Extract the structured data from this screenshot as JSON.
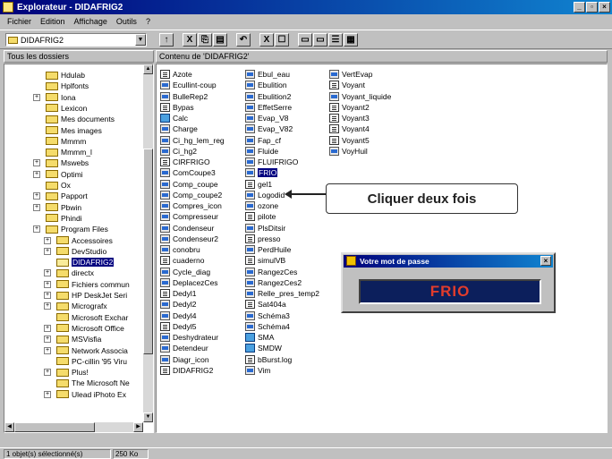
{
  "window": {
    "title": "Explorateur - DIDAFRIG2",
    "minimize": "_",
    "maximize": "▫",
    "close": "×"
  },
  "menu": [
    "Fichier",
    "Edition",
    "Affichage",
    "Outils",
    "?"
  ],
  "address": {
    "value": "DIDAFRIG2"
  },
  "toolbar": {
    "up": "↑",
    "cut": "X",
    "copy": "⎘",
    "paste": "▤",
    "undo": "↶",
    "delete": "X",
    "props": "☐",
    "view1": "▭",
    "view2": "▭",
    "view3": "☰",
    "view4": "▦"
  },
  "headers": {
    "tree": "Tous les dossiers",
    "content": "Contenu de 'DIDAFRIG2'"
  },
  "tree": [
    {
      "label": "Hdulab",
      "plus": false,
      "sel": false
    },
    {
      "label": "Hplfonts",
      "plus": false,
      "sel": false
    },
    {
      "label": "Iona",
      "plus": true,
      "sel": false
    },
    {
      "label": "Lexicon",
      "plus": false,
      "sel": false
    },
    {
      "label": "Mes documents",
      "plus": false,
      "sel": false
    },
    {
      "label": "Mes images",
      "plus": false,
      "sel": false
    },
    {
      "label": "Mmmm",
      "plus": false,
      "sel": false
    },
    {
      "label": "Mmmm_l",
      "plus": false,
      "sel": false
    },
    {
      "label": "Mswebs",
      "plus": true,
      "sel": false
    },
    {
      "label": "Optimi",
      "plus": true,
      "sel": false
    },
    {
      "label": "Ox",
      "plus": false,
      "sel": false
    },
    {
      "label": "Papport",
      "plus": true,
      "sel": false
    },
    {
      "label": "Pbwin",
      "plus": true,
      "sel": false
    },
    {
      "label": "Phindi",
      "plus": false,
      "sel": false
    },
    {
      "label": "Program Files",
      "plus": true,
      "sel": false
    },
    {
      "label": "Accessoires",
      "plus": true,
      "sel": false
    },
    {
      "label": "DevStudio",
      "plus": true,
      "sel": false
    },
    {
      "label": "DIDAFRIG2",
      "plus": false,
      "sel": true
    },
    {
      "label": "directx",
      "plus": true,
      "sel": false
    },
    {
      "label": "Fichiers commun",
      "plus": true,
      "sel": false
    },
    {
      "label": "HP DeskJet Seri",
      "plus": true,
      "sel": false
    },
    {
      "label": "Micrografx",
      "plus": true,
      "sel": false
    },
    {
      "label": "Microsoft Exchar",
      "plus": false,
      "sel": false
    },
    {
      "label": "Microsoft Office",
      "plus": true,
      "sel": false
    },
    {
      "label": "MSVisfia",
      "plus": true,
      "sel": false
    },
    {
      "label": "Network Associa",
      "plus": true,
      "sel": false
    },
    {
      "label": "PC-cillin '95 Viru",
      "plus": false,
      "sel": false
    },
    {
      "label": "Plus!",
      "plus": true,
      "sel": false
    },
    {
      "label": "The Microsoft Ne",
      "plus": false,
      "sel": false
    },
    {
      "label": "Ulead iPhoto Ex",
      "plus": true,
      "sel": false
    }
  ],
  "files": [
    [
      {
        "label": "Azote",
        "icon": "doc"
      },
      {
        "label": "Ecullint-coup",
        "icon": "sc"
      },
      {
        "label": "BulleRep2",
        "icon": "sc"
      },
      {
        "label": "Bypas",
        "icon": "doc"
      },
      {
        "label": "Calc",
        "icon": "app"
      },
      {
        "label": "Charge",
        "icon": "sc"
      },
      {
        "label": "Ci_hg_lem_reg",
        "icon": "sc"
      },
      {
        "label": "Ci_hg2",
        "icon": "sc"
      },
      {
        "label": "CIRFRIGO",
        "icon": "doc"
      },
      {
        "label": "ComCoupe3",
        "icon": "sc"
      },
      {
        "label": "Comp_coupe",
        "icon": "sc"
      },
      {
        "label": "Comp_coupe2",
        "icon": "sc"
      },
      {
        "label": "Compres_icon",
        "icon": "sc"
      },
      {
        "label": "Compresseur",
        "icon": "sc"
      },
      {
        "label": "Condenseur",
        "icon": "sc"
      },
      {
        "label": "Condenseur2",
        "icon": "sc"
      },
      {
        "label": "conobru",
        "icon": "sc"
      },
      {
        "label": "cuaderno",
        "icon": "doc"
      },
      {
        "label": "Cycle_diag",
        "icon": "sc"
      },
      {
        "label": "DeplacezCes",
        "icon": "sc"
      },
      {
        "label": "Dedyl1",
        "icon": "doc"
      },
      {
        "label": "Dedyl2",
        "icon": "sc"
      },
      {
        "label": "Dedyl4",
        "icon": "sc"
      },
      {
        "label": "Dedyl5",
        "icon": "doc"
      },
      {
        "label": "Deshydrateur",
        "icon": "sc"
      },
      {
        "label": "Detendeur",
        "icon": "sc"
      },
      {
        "label": "Diagr_icon",
        "icon": "sc"
      },
      {
        "label": "DIDAFRIG2",
        "icon": "doc"
      }
    ],
    [
      {
        "label": "Ebul_eau",
        "icon": "sc"
      },
      {
        "label": "Ebulition",
        "icon": "sc"
      },
      {
        "label": "Ebulition2",
        "icon": "sc"
      },
      {
        "label": "EffetSerre",
        "icon": "sc"
      },
      {
        "label": "Evap_V8",
        "icon": "sc"
      },
      {
        "label": "Evap_V82",
        "icon": "sc"
      },
      {
        "label": "Fap_cf",
        "icon": "sc"
      },
      {
        "label": "Fluide",
        "icon": "sc"
      },
      {
        "label": "FLUIFRIGO",
        "icon": "sc"
      },
      {
        "label": "FRIO",
        "icon": "sc",
        "sel": true
      },
      {
        "label": "gel1",
        "icon": "doc"
      },
      {
        "label": "Logodid",
        "icon": "sc"
      },
      {
        "label": "ozone",
        "icon": "sc"
      },
      {
        "label": "pilote",
        "icon": "doc"
      },
      {
        "label": "PlsDitsir",
        "icon": "sc"
      },
      {
        "label": "presso",
        "icon": "doc"
      },
      {
        "label": "PerdHuile",
        "icon": "sc"
      },
      {
        "label": "simulVB",
        "icon": "doc"
      },
      {
        "label": "RangezCes",
        "icon": "sc"
      },
      {
        "label": "RangezCes2",
        "icon": "sc"
      },
      {
        "label": "Relle_pres_temp2",
        "icon": "sc"
      },
      {
        "label": "Sat404a",
        "icon": "doc"
      },
      {
        "label": "Schéma3",
        "icon": "sc"
      },
      {
        "label": "Schéma4",
        "icon": "sc"
      },
      {
        "label": "SMA",
        "icon": "app"
      },
      {
        "label": "SMDW",
        "icon": "app"
      },
      {
        "label": "bBurst.log",
        "icon": "doc"
      },
      {
        "label": "Vim",
        "icon": "sc"
      }
    ],
    [
      {
        "label": "VertEvap",
        "icon": "sc"
      },
      {
        "label": "Voyant",
        "icon": "doc"
      },
      {
        "label": "Voyant_liquide",
        "icon": "sc"
      },
      {
        "label": "Voyant2",
        "icon": "doc"
      },
      {
        "label": "Voyant3",
        "icon": "doc"
      },
      {
        "label": "Voyant4",
        "icon": "doc"
      },
      {
        "label": "Voyant5",
        "icon": "doc"
      },
      {
        "label": "VoyHuil",
        "icon": "sc"
      }
    ]
  ],
  "callout": {
    "text": "Cliquer deux fois"
  },
  "password_dialog": {
    "title": "Votre mot de passe",
    "value": "FRIO",
    "close": "×"
  },
  "status": {
    "left": "1 objet(s) sélectionné(s)",
    "right": "250 Ko"
  }
}
